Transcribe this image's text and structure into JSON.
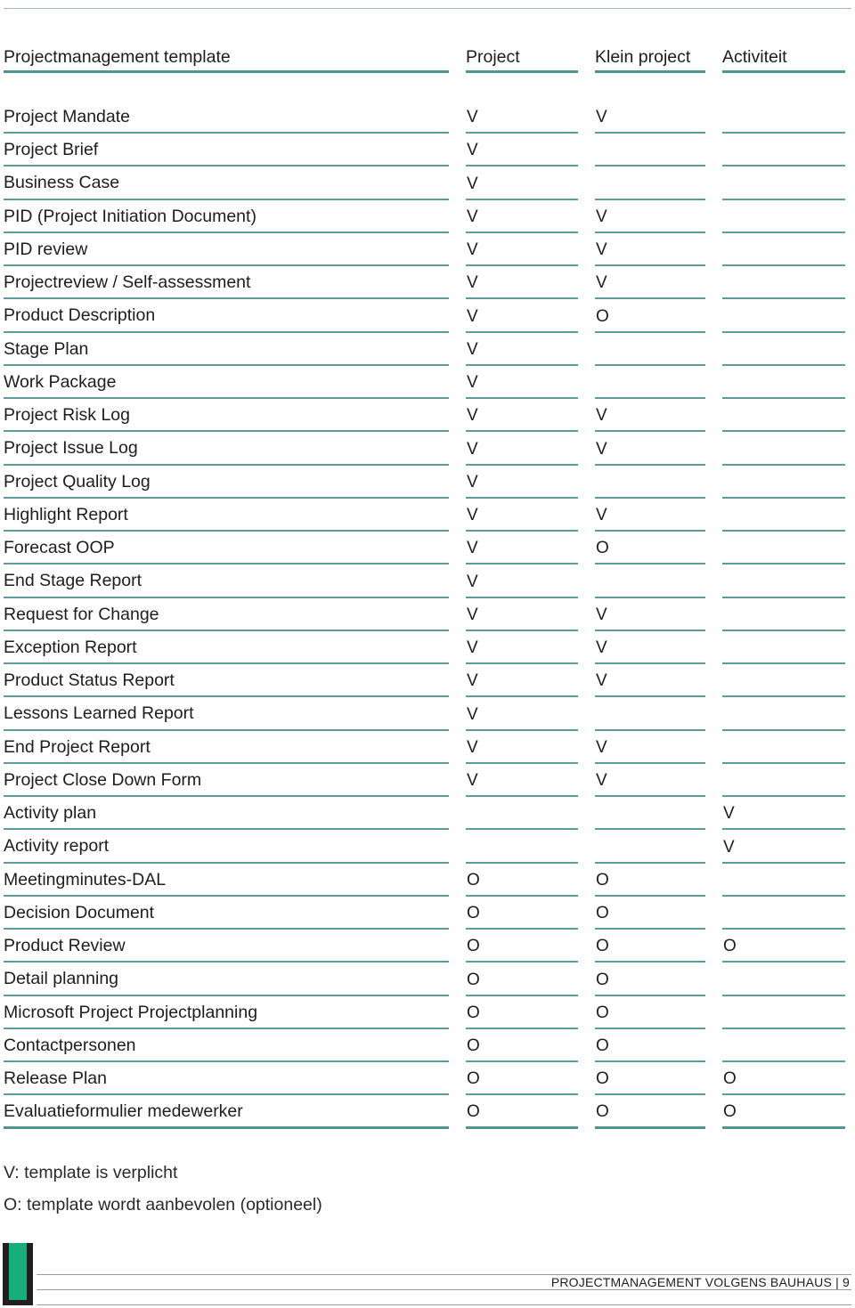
{
  "table": {
    "headers": [
      "Projectmanagement template",
      "Project",
      "Klein project",
      "Activiteit"
    ],
    "rows": [
      {
        "name": "Project Mandate",
        "project": "V",
        "klein_project": "V",
        "activiteit": ""
      },
      {
        "name": "Project Brief",
        "project": "V",
        "klein_project": "",
        "activiteit": ""
      },
      {
        "name": "Business Case",
        "project": "V",
        "klein_project": "",
        "activiteit": ""
      },
      {
        "name": "PID (Project Initiation Document)",
        "project": "V",
        "klein_project": "V",
        "activiteit": ""
      },
      {
        "name": "PID review",
        "project": "V",
        "klein_project": "V",
        "activiteit": ""
      },
      {
        "name": "Projectreview / Self-assessment",
        "project": "V",
        "klein_project": "V",
        "activiteit": ""
      },
      {
        "name": "Product Description",
        "project": "V",
        "klein_project": "O",
        "activiteit": ""
      },
      {
        "name": "Stage Plan",
        "project": "V",
        "klein_project": "",
        "activiteit": ""
      },
      {
        "name": "Work Package",
        "project": "V",
        "klein_project": "",
        "activiteit": ""
      },
      {
        "name": "Project Risk Log",
        "project": "V",
        "klein_project": "V",
        "activiteit": ""
      },
      {
        "name": "Project Issue Log",
        "project": "V",
        "klein_project": "V",
        "activiteit": ""
      },
      {
        "name": "Project Quality Log",
        "project": "V",
        "klein_project": "",
        "activiteit": ""
      },
      {
        "name": "Highlight Report",
        "project": "V",
        "klein_project": "V",
        "activiteit": ""
      },
      {
        "name": "Forecast OOP",
        "project": "V",
        "klein_project": "O",
        "activiteit": ""
      },
      {
        "name": "End Stage Report",
        "project": "V",
        "klein_project": "",
        "activiteit": ""
      },
      {
        "name": "Request for Change",
        "project": "V",
        "klein_project": "V",
        "activiteit": ""
      },
      {
        "name": "Exception Report",
        "project": "V",
        "klein_project": "V",
        "activiteit": ""
      },
      {
        "name": "Product Status Report",
        "project": "V",
        "klein_project": "V",
        "activiteit": ""
      },
      {
        "name": "Lessons Learned Report",
        "project": "V",
        "klein_project": "",
        "activiteit": ""
      },
      {
        "name": "End Project Report",
        "project": "V",
        "klein_project": "V",
        "activiteit": ""
      },
      {
        "name": "Project Close Down Form",
        "project": "V",
        "klein_project": "V",
        "activiteit": ""
      },
      {
        "name": "Activity plan",
        "project": "",
        "klein_project": "",
        "activiteit": "V"
      },
      {
        "name": "Activity report",
        "project": "",
        "klein_project": "",
        "activiteit": "V"
      },
      {
        "name": "Meetingminutes-DAL",
        "project": "O",
        "klein_project": "O",
        "activiteit": ""
      },
      {
        "name": "Decision Document",
        "project": "O",
        "klein_project": "O",
        "activiteit": ""
      },
      {
        "name": "Product Review",
        "project": "O",
        "klein_project": "O",
        "activiteit": "O"
      },
      {
        "name": "Detail planning",
        "project": "O",
        "klein_project": "O",
        "activiteit": ""
      },
      {
        "name": "Microsoft Project Projectplanning",
        "project": "O",
        "klein_project": "O",
        "activiteit": ""
      },
      {
        "name": "Contactpersonen",
        "project": "O",
        "klein_project": "O",
        "activiteit": ""
      },
      {
        "name": "Release Plan",
        "project": "O",
        "klein_project": "O",
        "activiteit": "O"
      },
      {
        "name": "Evaluatieformulier medewerker",
        "project": "O",
        "klein_project": "O",
        "activiteit": "O"
      }
    ]
  },
  "legend": {
    "v": "V: template is verplicht",
    "o": "O: template wordt aanbevolen (optioneel)"
  },
  "footer": {
    "text": "PROJECTMANAGEMENT VOLGENS BAUHAUS | 9"
  },
  "colors": {
    "rule": "#5b9c9c",
    "logo_green": "#16ae7a",
    "logo_dark": "#231f20"
  }
}
